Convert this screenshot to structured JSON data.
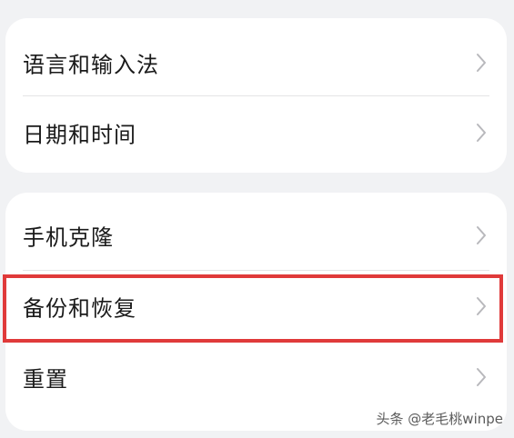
{
  "groups": [
    {
      "items": [
        {
          "label": "语言和输入法"
        },
        {
          "label": "日期和时间"
        }
      ]
    },
    {
      "items": [
        {
          "label": "手机克隆"
        },
        {
          "label": "备份和恢复",
          "highlighted": true
        },
        {
          "label": "重置"
        }
      ]
    }
  ],
  "annotation": {
    "highlight_color": "#e03a3a",
    "highlighted_item": "备份和恢复"
  },
  "watermark": "头条 @老毛桃winpe",
  "icons": {
    "row_chevron": "chevron-right-icon"
  }
}
